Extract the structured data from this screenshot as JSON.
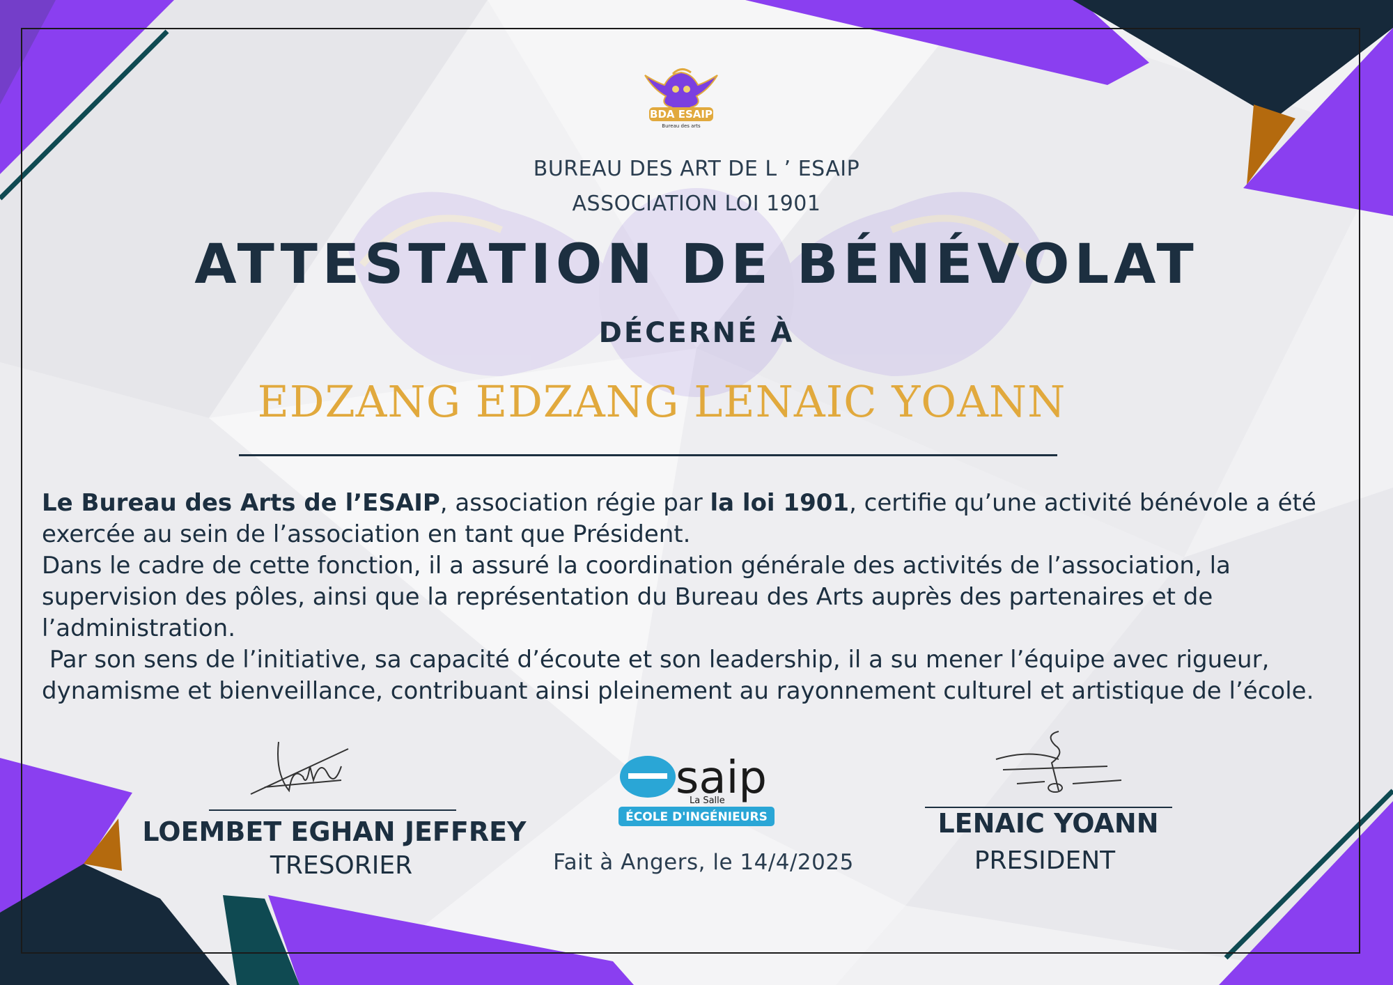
{
  "colors": {
    "purple": "#8a3ff0",
    "navy": "#16293a",
    "gold": "#e1a93d",
    "orange": "#b46a0e",
    "teal": "#0f4a52",
    "text": "#1c2f40"
  },
  "logo_top": {
    "icon": "owl-mascot-logo",
    "text": "BDA ESAIP",
    "subtext": "Bureau des arts"
  },
  "header": {
    "org_line1": "BUREAU DES ART DE L ’ ESAIP",
    "org_line2": "ASSOCIATION LOI 1901",
    "title": "ATTESTATION DE BÉNÉVOLAT",
    "awarded_to": "DÉCERNÉ À"
  },
  "recipient": {
    "name": "EDZANG EDZANG LENAIC YOANN"
  },
  "body": {
    "p1_bold1": "Le Bureau des Arts de l’ESAIP",
    "p1_text1": ", association régie par ",
    "p1_bold2": "la loi 1901",
    "p1_text2": ", certifie qu’une activité bénévole a été exercée au sein de l’association en tant que Président.",
    "p2": "Dans le cadre de cette fonction, il a assuré la coordination générale des activités de l’association, la supervision des pôles, ainsi que la représentation du Bureau des Arts auprès des partenaires et de l’administration.",
    "p3": " Par son sens de l’initiative, sa capacité d’écoute et son leadership, il a su mener l’équipe avec rigueur, dynamisme et bienveillance, contribuant ainsi pleinement au rayonnement culturel et artistique de l’école."
  },
  "signatories": [
    {
      "name": "LOEMBET EGHAN JEFFREY",
      "role": "TRESORIER"
    },
    {
      "name": "LENAIC YOANN",
      "role": "PRESIDENT"
    }
  ],
  "school_logo": {
    "icon": "esaip-logo",
    "wordmark": "saip",
    "sub": "La Salle",
    "badge": "ÉCOLE D'INGÉNIEURS"
  },
  "place_date": "Fait à Angers, le 14/4/2025"
}
